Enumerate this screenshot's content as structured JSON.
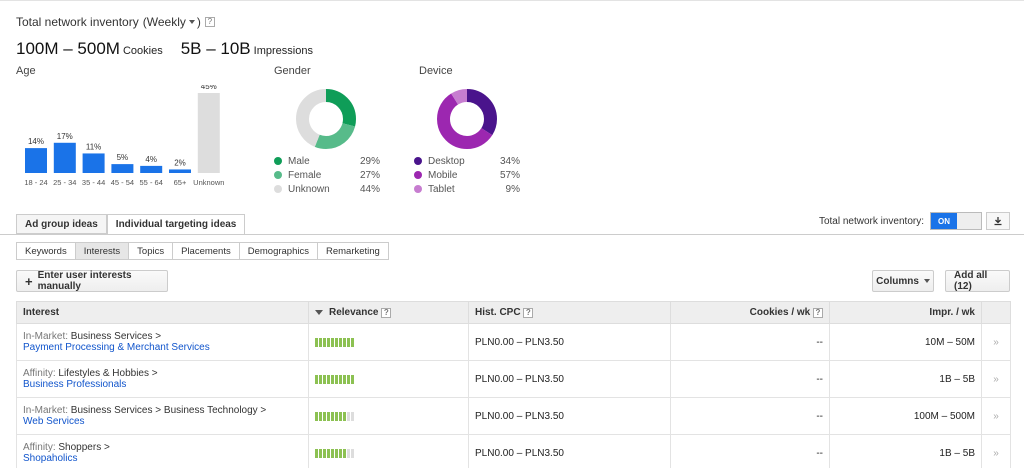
{
  "header": {
    "inventory_label": "Total network inventory",
    "period": "(Weekly",
    "period_close": ")",
    "help": "?",
    "cookies_value": "100M – 500M",
    "cookies_label": "Cookies",
    "impressions_value": "5B – 10B",
    "impressions_label": "Impressions"
  },
  "age": {
    "title": "Age",
    "chart_data": {
      "type": "bar",
      "categories": [
        "18 - 24",
        "25 - 34",
        "35 - 44",
        "45 - 54",
        "55 - 64",
        "65+",
        "Unknown"
      ],
      "values": [
        14,
        17,
        11,
        5,
        4,
        2,
        45
      ],
      "labels": [
        "14%",
        "17%",
        "11%",
        "5%",
        "4%",
        "2%",
        "45%"
      ],
      "colors": [
        "#1a73e8",
        "#1a73e8",
        "#1a73e8",
        "#1a73e8",
        "#1a73e8",
        "#1a73e8",
        "#dddddd"
      ]
    }
  },
  "gender": {
    "title": "Gender",
    "chart_data": {
      "type": "pie",
      "categories": [
        "Male",
        "Female",
        "Unknown"
      ],
      "values": [
        29,
        27,
        44
      ],
      "labels": [
        "29%",
        "27%",
        "44%"
      ],
      "colors": [
        "#0f9d58",
        "#57bb8a",
        "#dddddd"
      ]
    }
  },
  "device": {
    "title": "Device",
    "chart_data": {
      "type": "pie",
      "categories": [
        "Desktop",
        "Mobile",
        "Tablet"
      ],
      "values": [
        34,
        57,
        9
      ],
      "labels": [
        "34%",
        "57%",
        "9%"
      ],
      "colors": [
        "#4a148c",
        "#9c27b0",
        "#c77dd0"
      ]
    }
  },
  "tabs": {
    "ad_group": "Ad group ideas",
    "individual": "Individual targeting ideas"
  },
  "toggle": {
    "label": "Total network inventory:",
    "state": "ON"
  },
  "subtabs": [
    "Keywords",
    "Interests",
    "Topics",
    "Placements",
    "Demographics",
    "Remarketing"
  ],
  "actions": {
    "enter_interests": "Enter user interests manually",
    "columns": "Columns",
    "add_all": "Add all (12)"
  },
  "table": {
    "headers": {
      "interest": "Interest",
      "relevance": "Relevance",
      "hist_cpc": "Hist. CPC",
      "cookies": "Cookies / wk",
      "impr": "Impr. / wk"
    },
    "rows": [
      {
        "category": "In-Market:",
        "path": "Business Services >",
        "name": "Payment Processing & Merchant Services",
        "relevance": 1.0,
        "cpc": "PLN0.00 – PLN3.50",
        "cookies": "--",
        "impr": "10M – 50M"
      },
      {
        "category": "Affinity:",
        "path": "Lifestyles & Hobbies >",
        "name": "Business Professionals",
        "relevance": 1.0,
        "cpc": "PLN0.00 – PLN3.50",
        "cookies": "--",
        "impr": "1B – 5B"
      },
      {
        "category": "In-Market:",
        "path": "Business Services > Business Technology >",
        "name": "Web Services",
        "relevance": 0.8,
        "cpc": "PLN0.00 – PLN3.50",
        "cookies": "--",
        "impr": "100M – 500M"
      },
      {
        "category": "Affinity:",
        "path": "Shoppers >",
        "name": "Shopaholics",
        "relevance": 0.8,
        "cpc": "PLN0.00 – PLN3.50",
        "cookies": "--",
        "impr": "1B – 5B"
      }
    ]
  },
  "icons": {
    "row_action": "»",
    "download": "download-icon"
  }
}
